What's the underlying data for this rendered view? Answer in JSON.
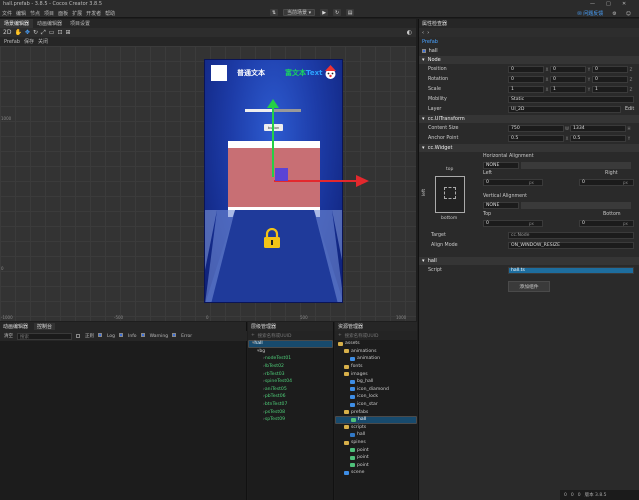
{
  "window": {
    "title": "hall.prefab - 3.8.5 - Cocos Creator 3.8.5",
    "controls": [
      "—",
      "□",
      "✕"
    ]
  },
  "menu": {
    "items": [
      "文件",
      "编辑",
      "节点",
      "项目",
      "面板",
      "扩展",
      "开发者",
      "帮助"
    ],
    "scene_select": "当前场景",
    "right_button": "问题反馈"
  },
  "scene_editor": {
    "tabs": [
      "场景编辑器",
      "动画编辑器",
      "项目设置"
    ],
    "tool_label": "2D",
    "prefab_bar": [
      "Prefab",
      "保存",
      "关闭"
    ],
    "ruler_labels": [
      "1000",
      "0",
      "-1000",
      "-500",
      "0",
      "500",
      "1000"
    ],
    "canvas": {
      "plain_text": "普通文本",
      "rich_text_a": "富文本",
      "rich_text_b": "Text",
      "button_label": "button",
      "slider_progress": 0.5
    }
  },
  "console": {
    "tabs": [
      "动画编辑器",
      "控制台"
    ],
    "toolbar": {
      "clear": "清空",
      "search_placeholder": "搜索",
      "regex": "正则",
      "log": "Log",
      "info": "Info",
      "warning": "Warning",
      "error": "Error"
    }
  },
  "hierarchy": {
    "title": "层级管理器",
    "search_placeholder": "搜索名称或UUID",
    "items": [
      {
        "label": "hall",
        "indent": 0,
        "selected": true,
        "green": false
      },
      {
        "label": "bg",
        "indent": 1,
        "selected": false,
        "green": false
      },
      {
        "label": "nodeTest01",
        "indent": 2,
        "selected": false,
        "green": true
      },
      {
        "label": "lbTest02",
        "indent": 2,
        "selected": false,
        "green": true
      },
      {
        "label": "rbTest03",
        "indent": 2,
        "selected": false,
        "green": true
      },
      {
        "label": "spineTest04",
        "indent": 2,
        "selected": false,
        "green": true
      },
      {
        "label": "aniTest05",
        "indent": 2,
        "selected": false,
        "green": true
      },
      {
        "label": "pbTest06",
        "indent": 2,
        "selected": false,
        "green": true
      },
      {
        "label": "btnTest07",
        "indent": 2,
        "selected": false,
        "green": true
      },
      {
        "label": "psTest08",
        "indent": 2,
        "selected": false,
        "green": true
      },
      {
        "label": "spTest09",
        "indent": 2,
        "selected": false,
        "green": true
      }
    ]
  },
  "assets": {
    "title": "资源管理器",
    "search_placeholder": "搜索名称或UUID",
    "items": [
      {
        "label": "assets",
        "indent": 0,
        "icon": "folder"
      },
      {
        "label": "animations",
        "indent": 1,
        "icon": "folder"
      },
      {
        "label": "animation",
        "indent": 2,
        "icon": "anim"
      },
      {
        "label": "fonts",
        "indent": 1,
        "icon": "folder"
      },
      {
        "label": "images",
        "indent": 1,
        "icon": "folder"
      },
      {
        "label": "bg_hall",
        "indent": 2,
        "icon": "image"
      },
      {
        "label": "icon_diamond",
        "indent": 2,
        "icon": "image"
      },
      {
        "label": "icon_lock",
        "indent": 2,
        "icon": "image"
      },
      {
        "label": "icon_star",
        "indent": 2,
        "icon": "image"
      },
      {
        "label": "prefabs",
        "indent": 1,
        "icon": "folder"
      },
      {
        "label": "hall",
        "indent": 2,
        "icon": "prefab",
        "selected": true
      },
      {
        "label": "scripts",
        "indent": 1,
        "icon": "folder"
      },
      {
        "label": "hall",
        "indent": 2,
        "icon": "ts"
      },
      {
        "label": "spines",
        "indent": 1,
        "icon": "folder"
      },
      {
        "label": "point",
        "indent": 2,
        "icon": "spine"
      },
      {
        "label": "point",
        "indent": 2,
        "icon": "spine"
      },
      {
        "label": "point",
        "indent": 2,
        "icon": "spine"
      },
      {
        "label": "scene",
        "indent": 1,
        "icon": "scene"
      }
    ]
  },
  "inspector": {
    "title": "属性检查器",
    "prefab_label": "Prefab",
    "node_name": "hall",
    "node_section": "Node",
    "position": {
      "label": "Position",
      "x": "0",
      "y": "0",
      "z": "0"
    },
    "rotation": {
      "label": "Rotation",
      "x": "0",
      "y": "0",
      "z": "0"
    },
    "scale": {
      "label": "Scale",
      "x": "1",
      "y": "1",
      "z": "1"
    },
    "mobility": {
      "label": "Mobility",
      "value": "Static"
    },
    "layer": {
      "label": "Layer",
      "value": "UI_2D",
      "edit": "Edit"
    },
    "uitransform": {
      "title": "cc.UITransform",
      "content_size_label": "Content Size",
      "w": "750",
      "h": "1334",
      "anchor_label": "Anchor Point",
      "ax": "0.5",
      "ay": "0.5"
    },
    "widget": {
      "title": "cc.Widget",
      "horizontal_alignment": "Horizontal Alignment",
      "vertical_alignment": "Vertical Alignment",
      "none": "NONE",
      "top": "top",
      "left": "left",
      "bottom": "bottom",
      "left_label": "Left",
      "right_label": "Right",
      "top_label": "Top",
      "bottom_label": "Bottom",
      "left_value": "0",
      "right_value": "0",
      "top_value": "0",
      "bottom_value": "0",
      "unit": "px",
      "target_label": "Target",
      "target_value": "cc.Node",
      "align_mode_label": "Align Mode",
      "align_mode_value": "ON_WINDOW_RESIZE"
    },
    "hall_component": {
      "title": "hall",
      "script_label": "Script",
      "script_value": "hall.ts"
    },
    "add_component": "添加组件"
  },
  "status": {
    "version": "版本 3.8.5",
    "counts": [
      "0",
      "0",
      "0"
    ]
  }
}
